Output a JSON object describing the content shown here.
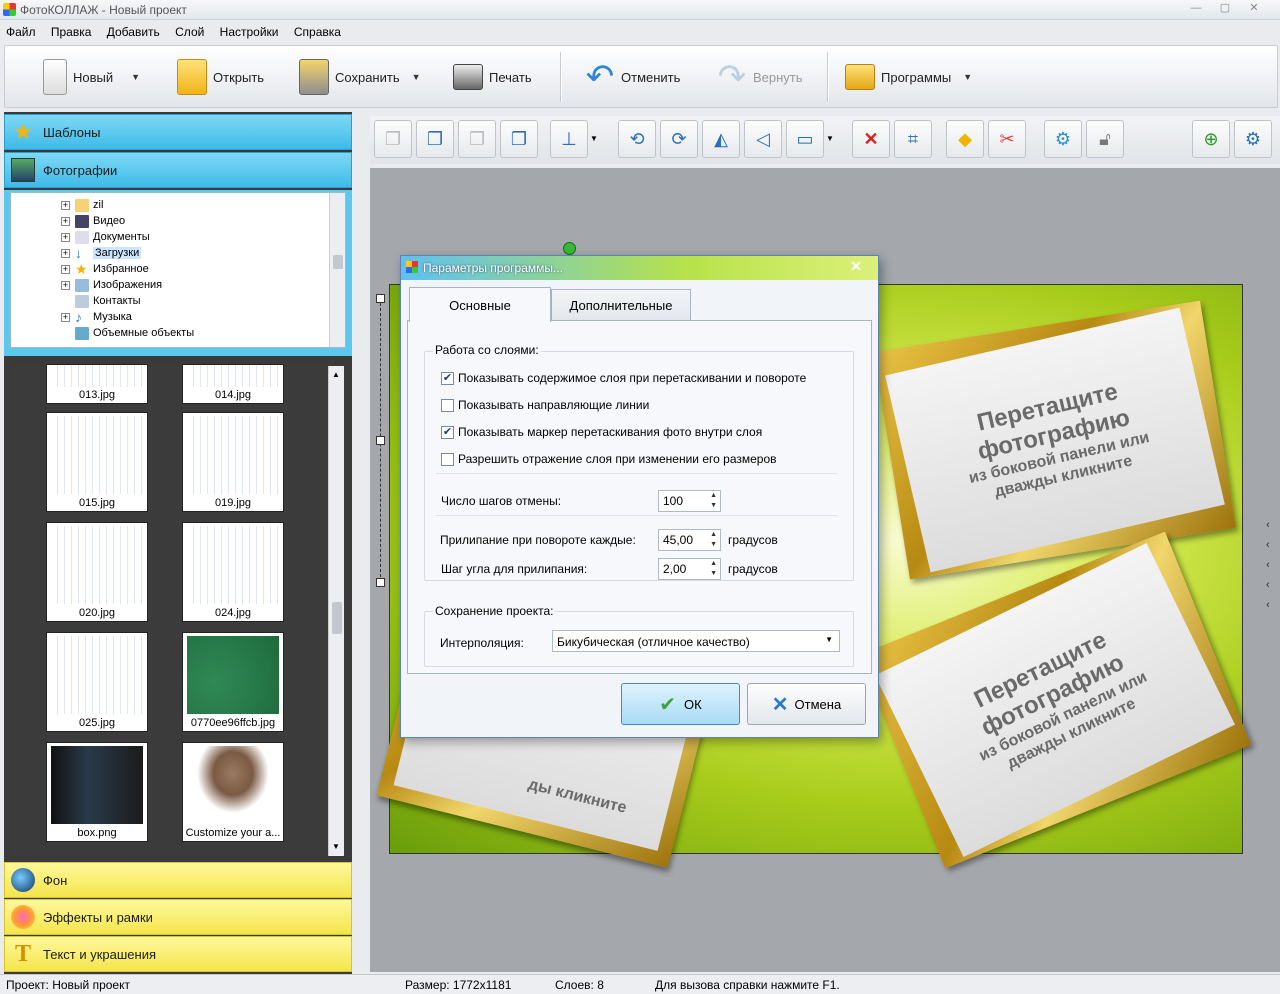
{
  "window": {
    "title": "ФотоКОЛЛАЖ - Новый проект"
  },
  "menu": [
    "Файл",
    "Правка",
    "Добавить",
    "Слой",
    "Настройки",
    "Справка"
  ],
  "toolbar": {
    "new_label": "Новый",
    "open_label": "Открыть",
    "save_label": "Сохранить",
    "print_label": "Печать",
    "undo_label": "Отменить",
    "redo_label": "Вернуть",
    "programs_label": "Программы"
  },
  "sidebar": {
    "templates": "Шаблоны",
    "photos": "Фотографии",
    "background": "Фон",
    "effects": "Эффекты и рамки",
    "text": "Текст и украшения"
  },
  "tree": [
    "zil",
    "Видео",
    "Документы",
    "Загрузки",
    "Избранное",
    "Изображения",
    "Контакты",
    "Музыка",
    "Объемные объекты"
  ],
  "thumbnails": [
    "013.jpg",
    "014.jpg",
    "015.jpg",
    "019.jpg",
    "020.jpg",
    "024.jpg",
    "025.jpg",
    "0770ee96ffcb.jpg",
    "box.png",
    "Customize your a..."
  ],
  "canvas": {
    "frame_big": "Перетащите фотографию",
    "frame_small": "из боковой панели или дважды кликните",
    "frame_partial": "ды кликните"
  },
  "dialog": {
    "title": "Параметры программы...",
    "tab_main": "Основные",
    "tab_extra": "Дополнительные",
    "group_layers": "Работа со слоями:",
    "check1": "Показывать содержимое слоя при перетаскивании и повороте",
    "check2": "Показывать направляющие линии",
    "check3": "Показывать маркер перетаскивания фото внутри слоя",
    "check4": "Разрешить отражение слоя при изменении его размеров",
    "undo_steps_label": "Число шагов отмены:",
    "undo_steps_value": "100",
    "snap_rotate_label": "Прилипание при повороте каждые:",
    "snap_rotate_value": "45,00",
    "snap_step_label": "Шаг угла для прилипания:",
    "snap_step_value": "2,00",
    "degrees": "градусов",
    "group_save": "Сохранение проекта:",
    "interp_label": "Интерполяция:",
    "interp_value": "Бикубическая (отличное качество)",
    "ok": "ОК",
    "cancel": "Отмена"
  },
  "status": {
    "project": "Проект:  Новый проект",
    "size": "Размер:  1772x1181",
    "layers": "Слоев:  8",
    "help": "Для вызова справки нажмите F1."
  }
}
